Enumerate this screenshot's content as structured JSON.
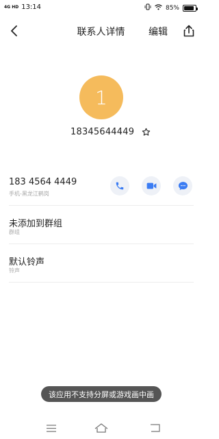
{
  "status_bar": {
    "signal": "4G HD",
    "time": "13:14",
    "battery_percent": "85%",
    "battery_level": 0.85,
    "icons": [
      "vibrate-icon",
      "wifi-icon",
      "battery-icon"
    ]
  },
  "header": {
    "title": "联系人详情",
    "edit_label": "编辑",
    "icons": [
      "back-arrow-icon",
      "share-icon"
    ]
  },
  "contact": {
    "avatar_initial": "1",
    "avatar_color": "#f5bb5c",
    "phone_heading": "18345644449",
    "star_icon": "star-outline-icon"
  },
  "phone_row": {
    "number": "183 4564 4449",
    "subtitle": "手机-黑龙江鹤岗",
    "actions": [
      "phone-icon",
      "video-icon",
      "message-icon"
    ],
    "action_color": "#3b7cf3"
  },
  "group_row": {
    "label": "未添加到群组",
    "subtitle": "群组"
  },
  "ringtone_row": {
    "label": "默认铃声",
    "subtitle": "铃声"
  },
  "toast": {
    "text": "该应用不支持分屏或游戏画中画"
  },
  "nav_bar": {
    "icons": [
      "menu-icon",
      "home-icon",
      "back-icon"
    ]
  }
}
